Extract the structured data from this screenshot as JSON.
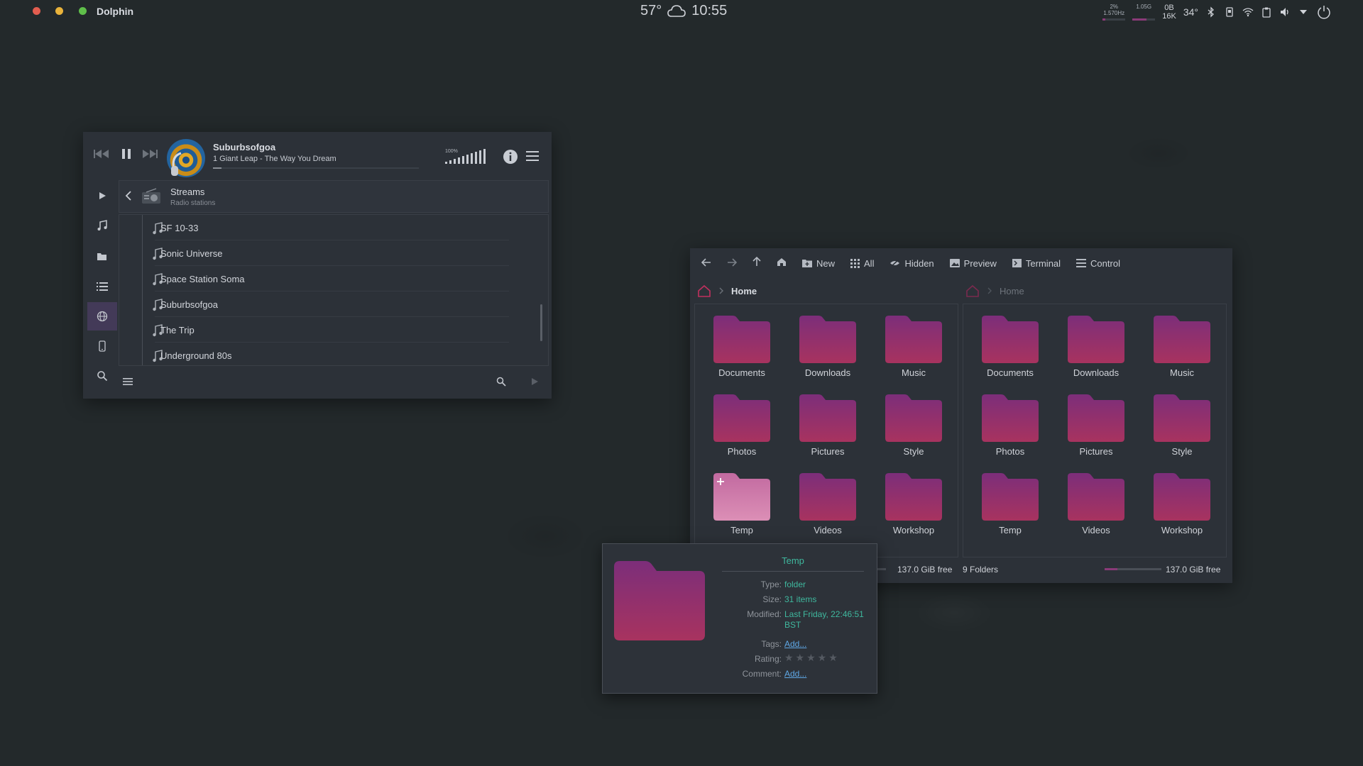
{
  "topbar": {
    "app_name": "Dolphin",
    "temperature": "57°",
    "time": "10:55",
    "cpu_percent": "2%",
    "cpu_freq": "1.570Hz",
    "mem": "1.05G",
    "net_up": "0B",
    "net_down": "16K",
    "cpu_temp": "34°",
    "traffic_lights": [
      "#e25d4f",
      "#e9b33b",
      "#5fbf4a"
    ]
  },
  "player": {
    "track_title": "Suburbsofgoa",
    "track_artist": "1 Giant Leap - The Way You Dream",
    "volume_label": "100%",
    "volume_level": 1.0,
    "streams_title": "Streams",
    "streams_subtitle": "Radio stations",
    "stations": [
      {
        "name": "SF 10-33"
      },
      {
        "name": "Sonic Universe"
      },
      {
        "name": "Space Station Soma"
      },
      {
        "name": "Suburbsofgoa"
      },
      {
        "name": "The Trip"
      },
      {
        "name": "Underground 80s"
      }
    ]
  },
  "fm": {
    "toolbar": {
      "new": "New",
      "all": "All",
      "hidden": "Hidden",
      "preview": "Preview",
      "terminal": "Terminal",
      "control": "Control"
    },
    "left_crumb": "Home",
    "right_crumb": "Home",
    "left_folders": [
      {
        "name": "Documents"
      },
      {
        "name": "Downloads"
      },
      {
        "name": "Music"
      },
      {
        "name": "Photos"
      },
      {
        "name": "Pictures"
      },
      {
        "name": "Style"
      },
      {
        "name": "Temp"
      },
      {
        "name": "Videos"
      },
      {
        "name": "Workshop"
      }
    ],
    "right_folders": [
      {
        "name": "Documents"
      },
      {
        "name": "Downloads"
      },
      {
        "name": "Music"
      },
      {
        "name": "Photos"
      },
      {
        "name": "Pictures"
      },
      {
        "name": "Style"
      },
      {
        "name": "Temp"
      },
      {
        "name": "Videos"
      },
      {
        "name": "Workshop"
      }
    ],
    "status": {
      "left_free": "137.0 GiB free",
      "left_count": "9 Folders",
      "right_free": "137.0 GiB free"
    },
    "folder_color_top": "#7c2e7a",
    "folder_color_bottom": "#a8335f"
  },
  "tooltip": {
    "title": "Temp",
    "rows": [
      {
        "key": "Type:",
        "value": "folder"
      },
      {
        "key": "Size:",
        "value": "31 items"
      },
      {
        "key": "Modified:",
        "value": "Last Friday, 22:46:51 BST"
      },
      {
        "key": "Tags:",
        "value": "Add..."
      },
      {
        "key": "Rating:",
        "value": ""
      },
      {
        "key": "Comment:",
        "value": "Add..."
      }
    ],
    "rating": 0
  }
}
